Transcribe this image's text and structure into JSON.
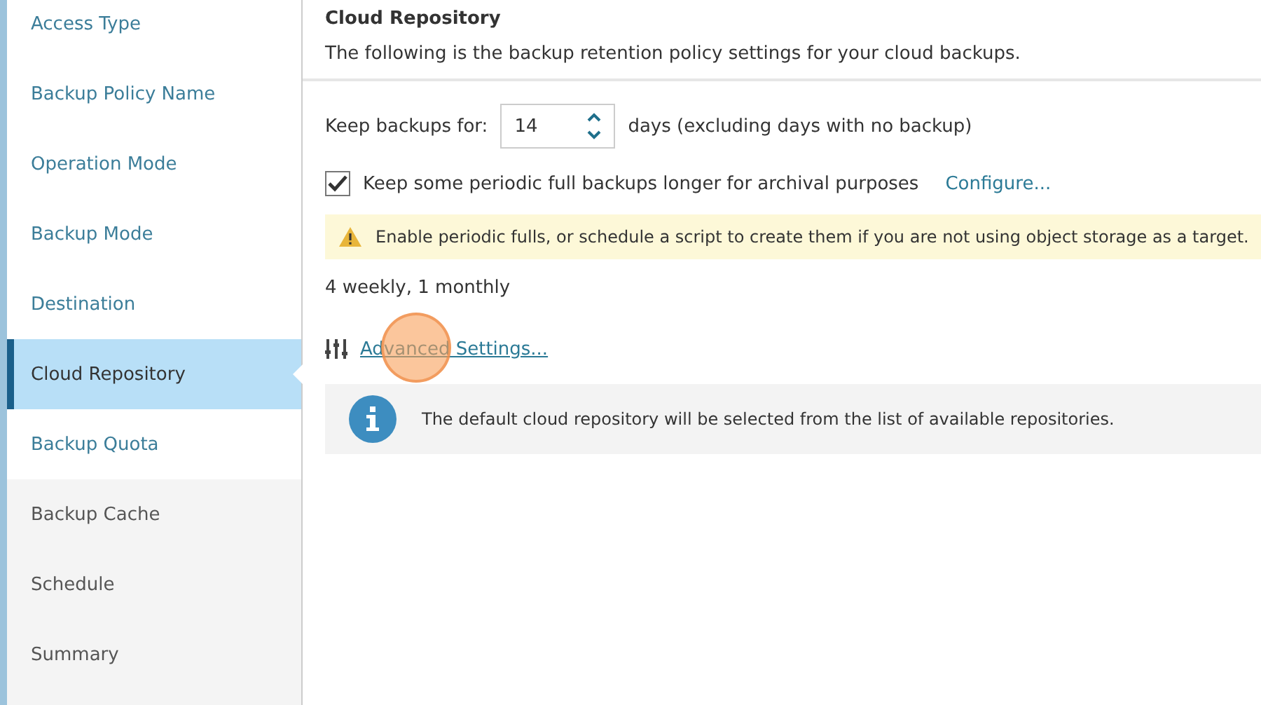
{
  "sidebar": {
    "items": [
      {
        "label": "Access Type",
        "selected": false,
        "visited": true
      },
      {
        "label": "Backup Policy Name",
        "selected": false,
        "visited": true
      },
      {
        "label": "Operation Mode",
        "selected": false,
        "visited": true
      },
      {
        "label": "Backup Mode",
        "selected": false,
        "visited": true
      },
      {
        "label": "Destination",
        "selected": false,
        "visited": true
      },
      {
        "label": "Cloud Repository",
        "selected": true,
        "visited": true
      },
      {
        "label": "Backup Quota",
        "selected": false,
        "visited": true
      },
      {
        "label": "Backup Cache",
        "selected": false,
        "visited": false
      },
      {
        "label": "Schedule",
        "selected": false,
        "visited": false
      },
      {
        "label": "Summary",
        "selected": false,
        "visited": false
      }
    ]
  },
  "header": {
    "title": "Cloud Repository",
    "subtitle": "The following is the backup retention policy settings for your cloud backups."
  },
  "retention": {
    "label": "Keep backups for:",
    "value": "14",
    "unit": "days (excluding days with no backup)"
  },
  "archival": {
    "label": "Keep some periodic full backups longer for archival purposes",
    "checked": true,
    "link": "Configure..."
  },
  "warning": {
    "text": "Enable periodic fulls, or schedule a script to create them if you are not using object storage as a target."
  },
  "archival_summary": "4 weekly, 1 monthly",
  "advanced_link": "Advanced Settings...",
  "info": {
    "text": "The default cloud repository will be selected from the list of available repositories."
  }
}
